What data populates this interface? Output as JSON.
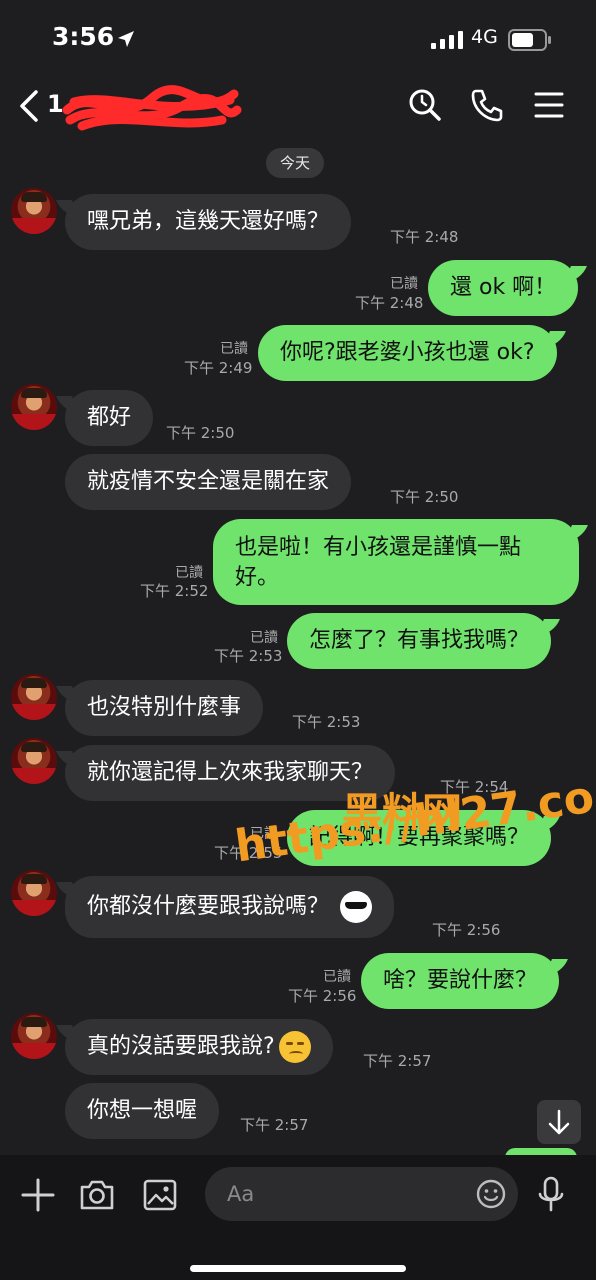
{
  "status": {
    "time": "3:56",
    "network": "4G"
  },
  "header": {
    "title": "1"
  },
  "date_divider": "今天",
  "messages": [
    {
      "dir": "in",
      "text": "嘿兄弟，這幾天還好嗎？",
      "time": "下午 2:48"
    },
    {
      "dir": "out",
      "text": "還 ok 啊！",
      "time": "下午 2:48",
      "read": "已讀"
    },
    {
      "dir": "out",
      "text": "你呢?跟老婆小孩也還 ok?",
      "time": "下午 2:49",
      "read": "已讀"
    },
    {
      "dir": "in",
      "text": "都好",
      "time": "下午 2:50"
    },
    {
      "dir": "in",
      "text": "就疫情不安全還是關在家",
      "time": "下午 2:50"
    },
    {
      "dir": "out",
      "text": "也是啦！有小孩還是謹慎一點好。",
      "time": "下午 2:52",
      "read": "已讀"
    },
    {
      "dir": "out",
      "text": "怎麼了？有事找我嗎？",
      "time": "下午 2:53",
      "read": "已讀"
    },
    {
      "dir": "in",
      "text": "也沒特別什麼事",
      "time": "下午 2:53"
    },
    {
      "dir": "in",
      "text": "就你還記得上次來我家聊天？",
      "time": "下午 2:54"
    },
    {
      "dir": "out",
      "text": "記得啊！要再聚聚嗎？",
      "time": "下午 2:55",
      "read": "已讀"
    },
    {
      "dir": "in",
      "text": "你都沒什麼要跟我說嗎？",
      "time": "下午 2:56",
      "emoji": "sunglasses-emoji"
    },
    {
      "dir": "out",
      "text": "啥？要說什麼？",
      "time": "下午 2:56",
      "read": "已讀"
    },
    {
      "dir": "in",
      "text": "真的沒話要跟我說?",
      "time": "下午 2:57",
      "emoji": "smirk-emoji"
    },
    {
      "dir": "in",
      "text": "你想一想喔",
      "time": "下午 2:57"
    }
  ],
  "input": {
    "placeholder": "Aa"
  },
  "watermark": {
    "site": "黑料网",
    "url": "https://hl27.co"
  },
  "colors": {
    "background": "#1e1e20",
    "incoming_bubble": "#323235",
    "outgoing_bubble": "#6fe36b",
    "accent_redaction": "#ff2a2a",
    "watermark": "#f29b22"
  }
}
